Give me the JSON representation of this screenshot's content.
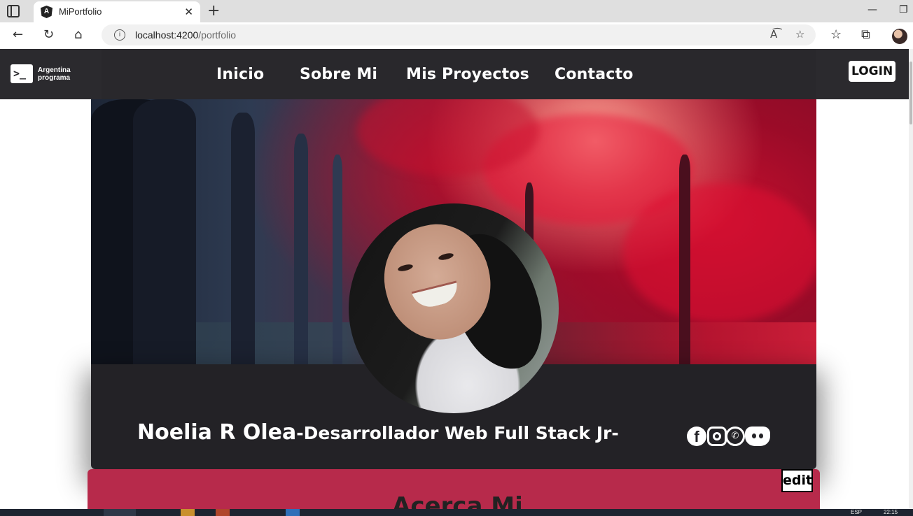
{
  "browser": {
    "tab_title": "MiPortfolio",
    "url_host": "localhost:4200",
    "url_path": "/portfolio"
  },
  "navbar": {
    "logo_line1": "Argentina",
    "logo_line2": "programa",
    "links": [
      "Inicio",
      "Sobre Mi",
      "Mis Proyectos",
      "Contacto"
    ],
    "login_label": "LOGIN"
  },
  "profile": {
    "name": "Noelia R Olea",
    "role": "-Desarrollador Web Full Stack Jr-",
    "social_icons": [
      "facebook-icon",
      "instagram-icon",
      "whatsapp-icon",
      "discord-icon"
    ]
  },
  "about": {
    "title": "Acerca Mi",
    "edit_label": "edit"
  },
  "taskbar": {
    "lang": "ESP",
    "time": "22:15"
  },
  "colors": {
    "nav_bg": "#2b2a2e",
    "card_bg": "#232226",
    "about_bg": "#b72a4b"
  }
}
